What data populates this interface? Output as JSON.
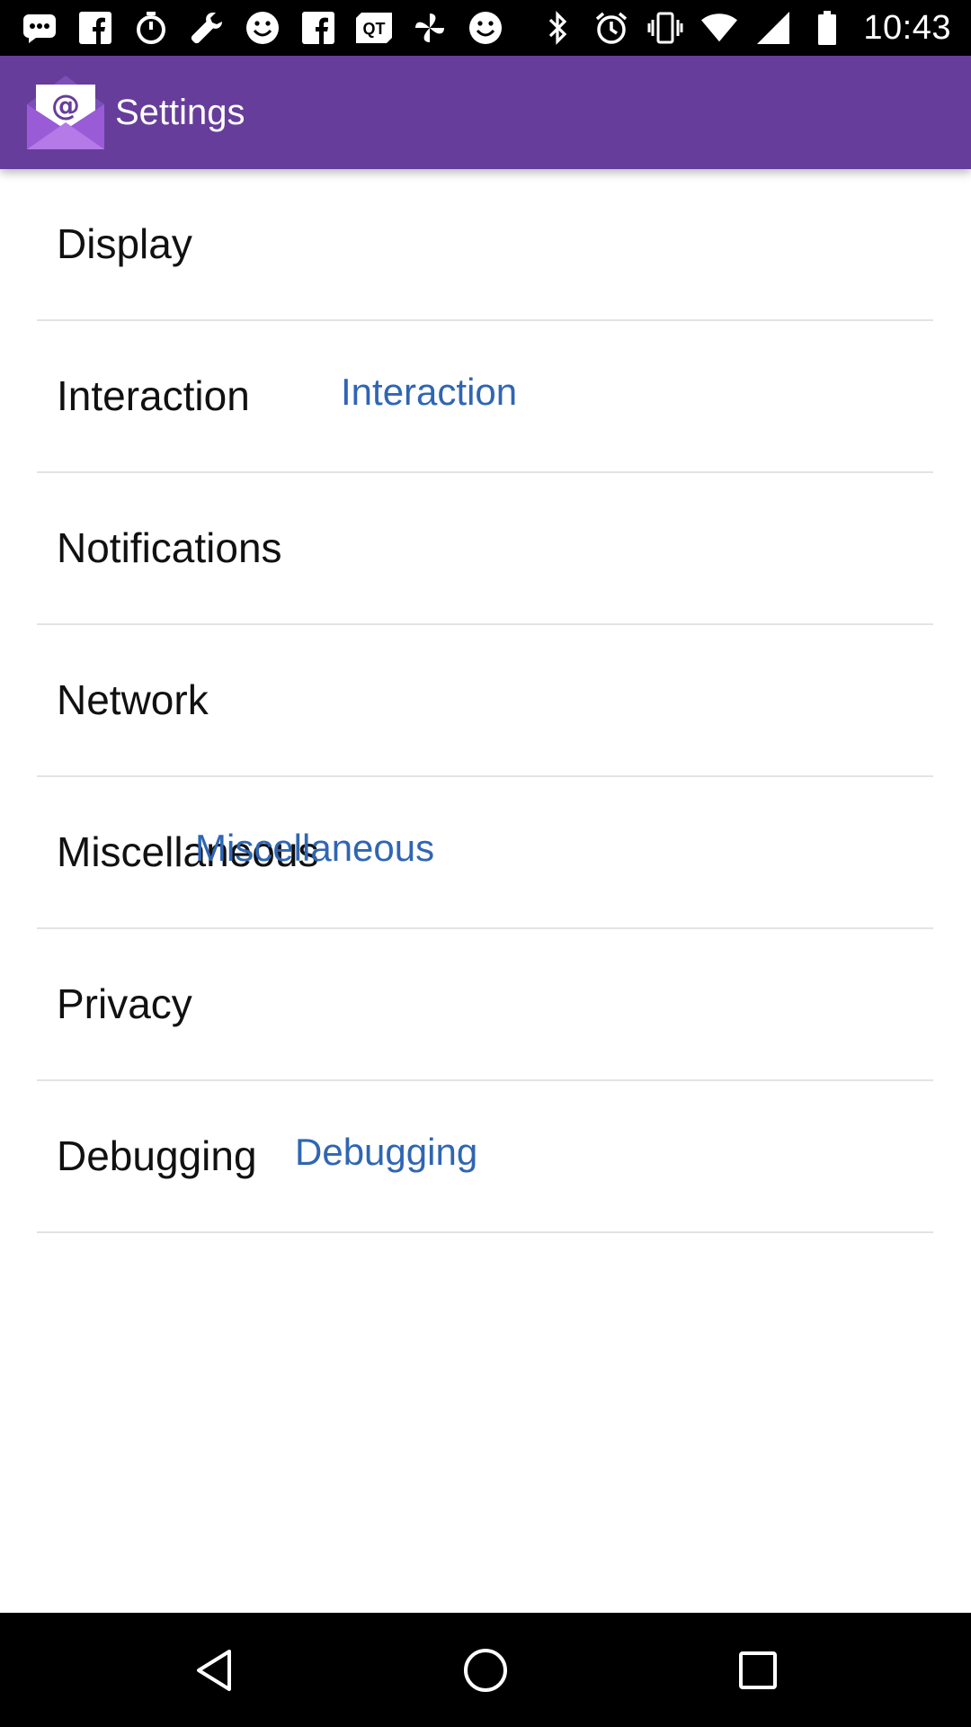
{
  "status_bar": {
    "time": "10:43",
    "left_icons": [
      "message-icon",
      "facebook-icon",
      "timer-icon",
      "wrench-icon",
      "smiley-icon",
      "facebook-icon",
      "qt-icon",
      "pinwheel-icon",
      "smiley-icon"
    ],
    "right_icons": [
      "bluetooth-icon",
      "alarm-icon",
      "vibrate-icon",
      "wifi-icon",
      "signal-icon",
      "battery-icon"
    ]
  },
  "app_bar": {
    "title": "Settings",
    "logo_icon": "email-envelope-icon",
    "color": "#673d9b"
  },
  "settings": {
    "items": [
      {
        "label": "Display",
        "overlay": ""
      },
      {
        "label": "Interaction",
        "overlay": "Interaction"
      },
      {
        "label": "Notifications",
        "overlay": ""
      },
      {
        "label": "Network",
        "overlay": ""
      },
      {
        "label": "Miscellaneous",
        "overlay": "Miscellaneous"
      },
      {
        "label": "Privacy",
        "overlay": ""
      },
      {
        "label": "Debugging",
        "overlay": "Debugging"
      }
    ],
    "overlay_color": "#2f66b3"
  },
  "nav_bar": {
    "buttons": [
      "back-icon",
      "home-icon",
      "recents-icon"
    ]
  }
}
